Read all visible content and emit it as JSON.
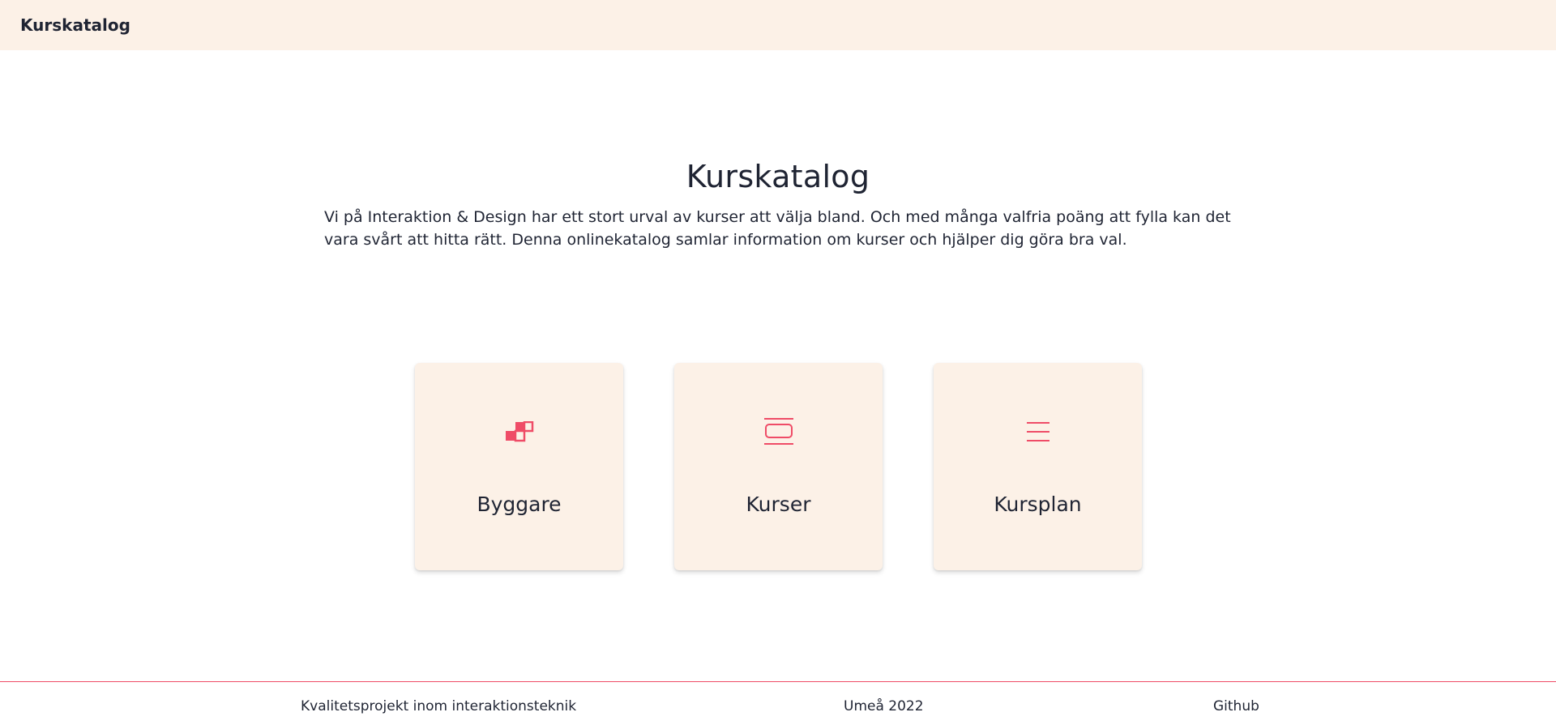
{
  "header": {
    "brand": "Kurskatalog"
  },
  "hero": {
    "title": "Kurskatalog",
    "description": "Vi på Interaktion & Design har ett stort urval av kurser att välja bland. Och med många valfria poäng att fylla kan det vara svårt att hitta rätt. Denna onlinekatalog samlar information om kurser och hjälper dig göra bra val."
  },
  "cards": [
    {
      "label": "Byggare",
      "icon": "builder-blocks-icon"
    },
    {
      "label": "Kurser",
      "icon": "course-cards-icon"
    },
    {
      "label": "Kursplan",
      "icon": "list-lines-icon"
    }
  ],
  "footer": {
    "project": "Kvalitetsprojekt inom interaktionsteknik",
    "location": "Umeå 2022",
    "github": "Github"
  },
  "colors": {
    "accent": "#ef4c67",
    "cream": "#fcf1e7",
    "text": "#1f2433"
  }
}
